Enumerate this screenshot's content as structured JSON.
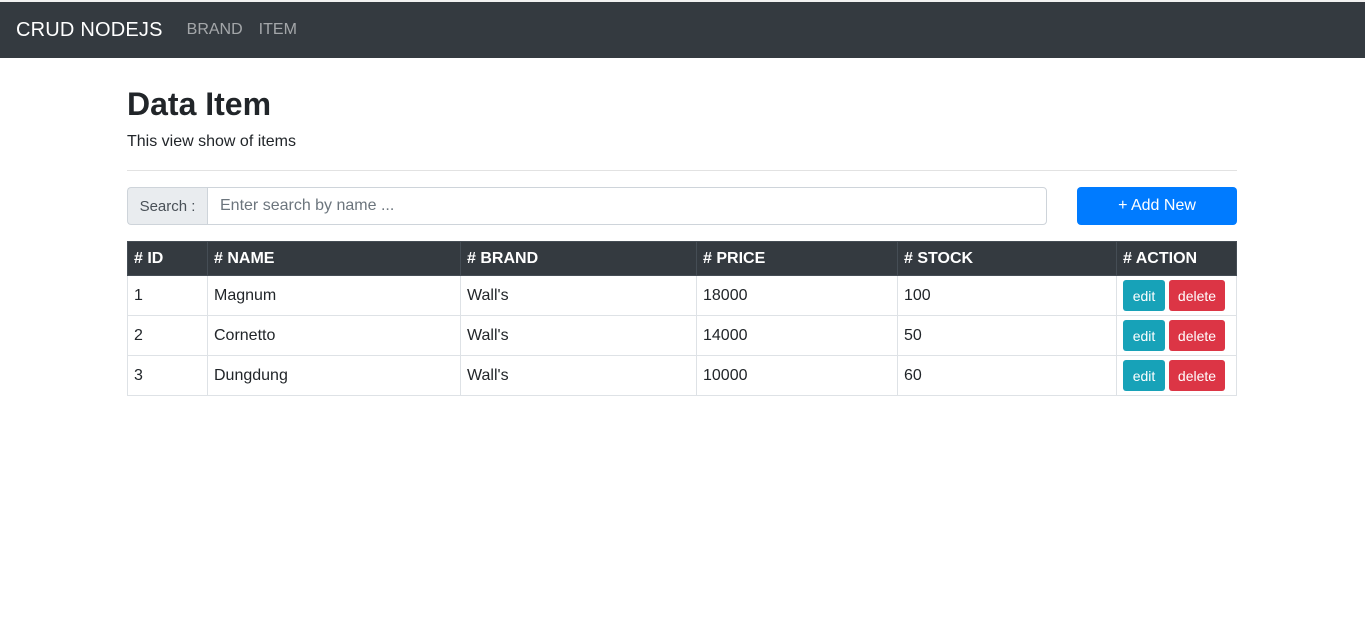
{
  "navbar": {
    "brand": "CRUD NODEJS",
    "links": [
      "BRAND",
      "ITEM"
    ]
  },
  "page": {
    "title": "Data Item",
    "subtitle": "This view show of items"
  },
  "search": {
    "label": "Search :",
    "placeholder": "Enter search by name ..."
  },
  "add_button": "+ Add New",
  "table": {
    "headers": [
      "# ID",
      "# NAME",
      "# BRAND",
      "# PRICE",
      "# STOCK",
      "# ACTION"
    ],
    "rows": [
      {
        "id": "1",
        "name": "Magnum",
        "brand": "Wall's",
        "price": "18000",
        "stock": "100"
      },
      {
        "id": "2",
        "name": "Cornetto",
        "brand": "Wall's",
        "price": "14000",
        "stock": "50"
      },
      {
        "id": "3",
        "name": "Dungdung",
        "brand": "Wall's",
        "price": "10000",
        "stock": "60"
      }
    ],
    "edit_label": "edit",
    "delete_label": "delete"
  },
  "colors": {
    "navbar": "#343a40",
    "primary": "#007bff",
    "info": "#17a2b8",
    "danger": "#dc3545"
  }
}
